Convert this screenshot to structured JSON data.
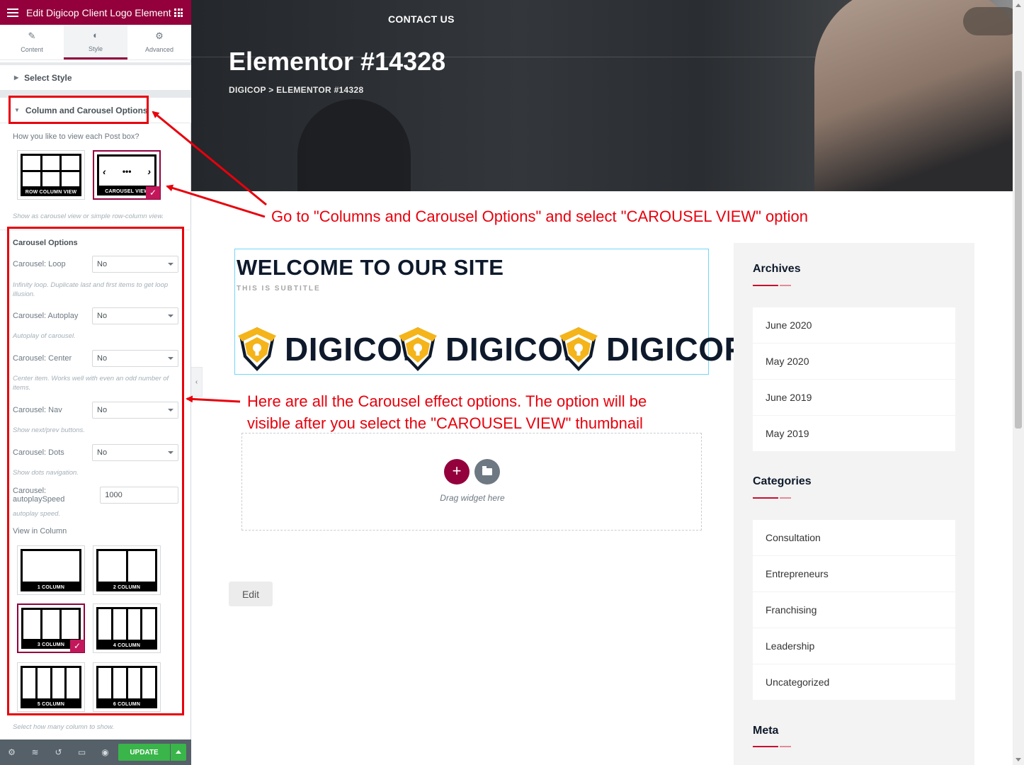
{
  "panel": {
    "header_title": "Edit Digicop Client Logo Element",
    "tabs": [
      {
        "label": "Content",
        "icon": "pencil-icon"
      },
      {
        "label": "Style",
        "icon": "contrast-icon"
      },
      {
        "label": "Advanced",
        "icon": "gear-icon"
      }
    ],
    "select_style_label": "Select Style",
    "column_carousel_label": "Column and Carousel Options",
    "view_question": "How you like to view each Post box?",
    "view_options": [
      {
        "caption": "ROW COLUMN VIEW",
        "selected": false
      },
      {
        "caption": "CAROUSEL VIEW",
        "selected": true
      }
    ],
    "view_hint": "Show as carousel view or simple row-column view.",
    "carousel_options_heading": "Carousel Options",
    "controls": {
      "loop": {
        "label": "Carousel: Loop",
        "value": "No",
        "hint": "Infinity loop. Duplicate last and first items to get loop illusion."
      },
      "autoplay": {
        "label": "Carousel: Autoplay",
        "value": "No",
        "hint": "Autoplay of carousel."
      },
      "center": {
        "label": "Carousel: Center",
        "value": "No",
        "hint": "Center item. Works well with even an odd number of items."
      },
      "nav": {
        "label": "Carousel: Nav",
        "value": "No",
        "hint": "Show next/prev buttons."
      },
      "dots": {
        "label": "Carousel: Dots",
        "value": "No",
        "hint": "Show dots navigation."
      },
      "speed": {
        "label": "Carousel: autoplaySpeed",
        "value": "1000",
        "hint": "autoplay speed."
      }
    },
    "view_in_column_label": "View in Column",
    "column_options": [
      {
        "caption": "1 COLUMN",
        "cols": 1,
        "selected": false
      },
      {
        "caption": "2 COLUMN",
        "cols": 2,
        "selected": false
      },
      {
        "caption": "3 COLUMN",
        "cols": 3,
        "selected": true
      },
      {
        "caption": "4 COLUMN",
        "cols": 4,
        "selected": false
      },
      {
        "caption": "5 COLUMN",
        "cols": 4,
        "selected": false
      },
      {
        "caption": "6 COLUMN",
        "cols": 4,
        "selected": false
      }
    ],
    "column_hint": "Select how many column to show.",
    "footer": {
      "icons": [
        "gear-icon",
        "layers-icon",
        "history-icon",
        "responsive-icon",
        "preview-eye-icon"
      ],
      "update_label": "UPDATE"
    }
  },
  "preview": {
    "nav_contact": "CONTACT US",
    "page_title": "Elementor #14328",
    "breadcrumb": "DIGICOP > ELEMENTOR #14328",
    "widget": {
      "title": "WELCOME TO OUR SITE",
      "subtitle": "THIS IS SUBTITLE",
      "logos": [
        "DIGICOP",
        "DIGICOP",
        "DIGICOP"
      ]
    },
    "drag_text": "Drag widget here",
    "edit_label": "Edit",
    "sidebar": {
      "archives_title": "Archives",
      "archives": [
        "June 2020",
        "May 2020",
        "June 2019",
        "May 2019"
      ],
      "categories_title": "Categories",
      "categories": [
        "Consultation",
        "Entrepreneurs",
        "Franchising",
        "Leadership",
        "Uncategorized"
      ],
      "meta_title": "Meta"
    }
  },
  "annotations": {
    "note1": "Go to \"Columns and Carousel Options\" and select \"CAROUSEL VIEW\" option",
    "note2_line1": "Here are all the Carousel effect options. The option will be",
    "note2_line2": "visible after you select the \"CAROUSEL VIEW\" thumbnail"
  },
  "colors": {
    "elementor_accent": "#93003c",
    "annotation_red": "#e8000c",
    "update_green": "#39b54a",
    "brand_gold": "#f4b41a",
    "brand_navy": "#0e1a2b",
    "heading_red": "#c8102e"
  }
}
